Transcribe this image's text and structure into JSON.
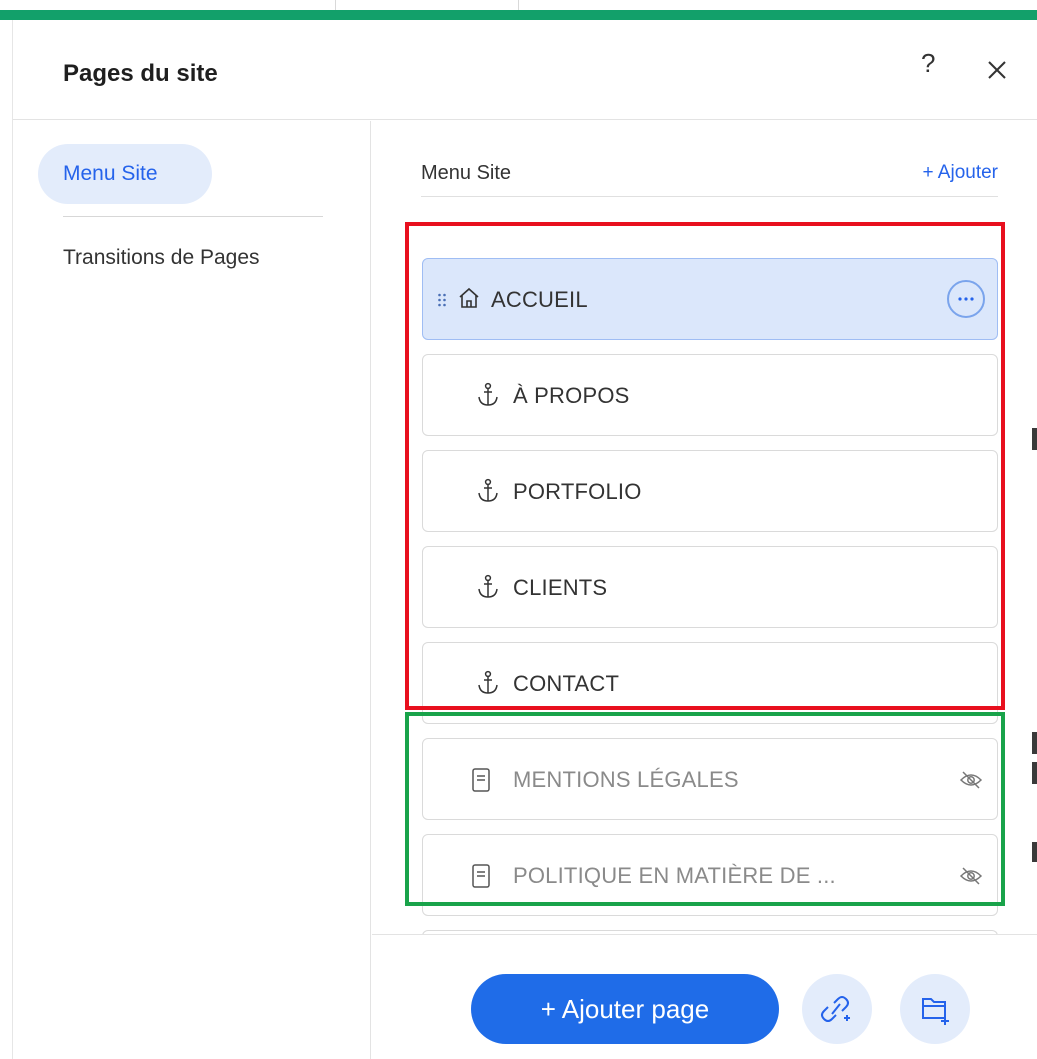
{
  "header": {
    "title": "Pages du site",
    "help_label": "?"
  },
  "sidebar": {
    "items": [
      {
        "label": "Menu Site",
        "active": true
      },
      {
        "label": "Transitions de Pages",
        "active": false
      }
    ]
  },
  "main": {
    "section_title": "Menu Site",
    "add_label": "+ Ajouter",
    "pages": [
      {
        "label": "ACCUEIL",
        "icon": "home-icon",
        "selected": true,
        "hidden": false
      },
      {
        "label": "À PROPOS",
        "icon": "anchor-icon",
        "selected": false,
        "hidden": false
      },
      {
        "label": "PORTFOLIO",
        "icon": "anchor-icon",
        "selected": false,
        "hidden": false
      },
      {
        "label": "CLIENTS",
        "icon": "anchor-icon",
        "selected": false,
        "hidden": false
      },
      {
        "label": "CONTACT",
        "icon": "anchor-icon",
        "selected": false,
        "hidden": false
      },
      {
        "label": "MENTIONS LÉGALES",
        "icon": "page-icon",
        "selected": false,
        "hidden": true
      },
      {
        "label": "POLITIQUE EN MATIÈRE DE ...",
        "icon": "page-icon",
        "selected": false,
        "hidden": true
      }
    ]
  },
  "footer": {
    "add_page_label": "+ Ajouter page"
  },
  "colors": {
    "accent": "#1f6ce8",
    "top_bar": "#12a06a",
    "highlight_red": "#e8101e",
    "highlight_green": "#19a34a"
  }
}
